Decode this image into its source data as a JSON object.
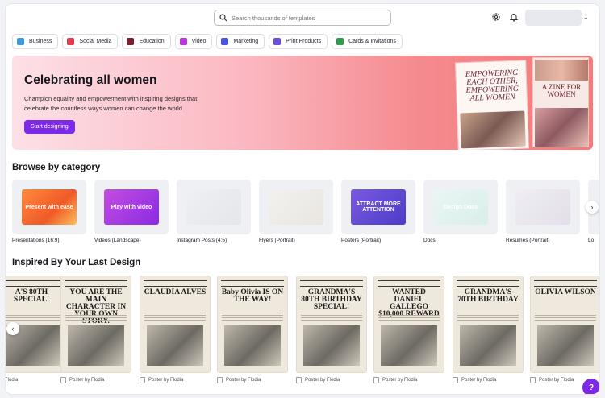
{
  "search": {
    "placeholder": "Search thousands of templates"
  },
  "header": {
    "settings_icon": "gear-icon",
    "notifications_icon": "bell-icon"
  },
  "chips": [
    {
      "label": "Business",
      "color": "#3d9bd9"
    },
    {
      "label": "Social Media",
      "color": "#e23c4f"
    },
    {
      "label": "Education",
      "color": "#7a1f2f"
    },
    {
      "label": "Video",
      "color": "#b83ad8"
    },
    {
      "label": "Marketing",
      "color": "#4a55d9"
    },
    {
      "label": "Print Products",
      "color": "#6b4fd6"
    },
    {
      "label": "Cards & Invitations",
      "color": "#2e9c4a"
    }
  ],
  "banner": {
    "title": "Celebrating all women",
    "description": "Champion equality and empowerment with inspiring designs that celebrate the countless ways women can change the world.",
    "cta": "Start designing",
    "poster1_text": "EMPOWERING EACH OTHER, EMPOWERING ALL WOMEN",
    "poster2_text": "A ZINE FOR WOMEN"
  },
  "browse": {
    "title": "Browse by category",
    "categories": [
      {
        "label": "Presentations (16:9)",
        "thumb_text": "Present with ease"
      },
      {
        "label": "Videos (Landscape)",
        "thumb_text": "Play with video"
      },
      {
        "label": "Instagram Posts (4:5)",
        "thumb_text": ""
      },
      {
        "label": "Flyers (Portrait)",
        "thumb_text": ""
      },
      {
        "label": "Posters (Portrait)",
        "thumb_text": "ATTRACT MORE ATTENTION"
      },
      {
        "label": "Docs",
        "thumb_text": "Design Docs"
      },
      {
        "label": "Resumes (Portrait)",
        "thumb_text": ""
      },
      {
        "label": "Lo",
        "thumb_text": ""
      }
    ]
  },
  "inspired": {
    "title": "Inspired By Your Last Design",
    "designs": [
      {
        "headline": "A'S 80TH SPECIAL!",
        "label": "Flodia"
      },
      {
        "headline": "YOU ARE THE MAIN CHARACTER IN YOUR OWN STORY.",
        "label": "Poster by Flodia"
      },
      {
        "headline": "CLAUDIA ALVES",
        "label": "Poster by Flodia"
      },
      {
        "headline": "Baby Olivia IS ON THE WAY!",
        "label": "Poster by Flodia"
      },
      {
        "headline": "GRANDMA'S 80TH BIRTHDAY SPECIAL!",
        "label": "Poster by Flodia"
      },
      {
        "headline": "WANTED DANIEL GALLEGO $10,000 REWARD",
        "label": "Poster by Flodia"
      },
      {
        "headline": "GRANDMA'S 70TH BIRTHDAY",
        "label": "Poster by Flodia"
      },
      {
        "headline": "OLIVIA WILSON",
        "label": "Poster by Flodia"
      }
    ]
  },
  "help_label": "?"
}
